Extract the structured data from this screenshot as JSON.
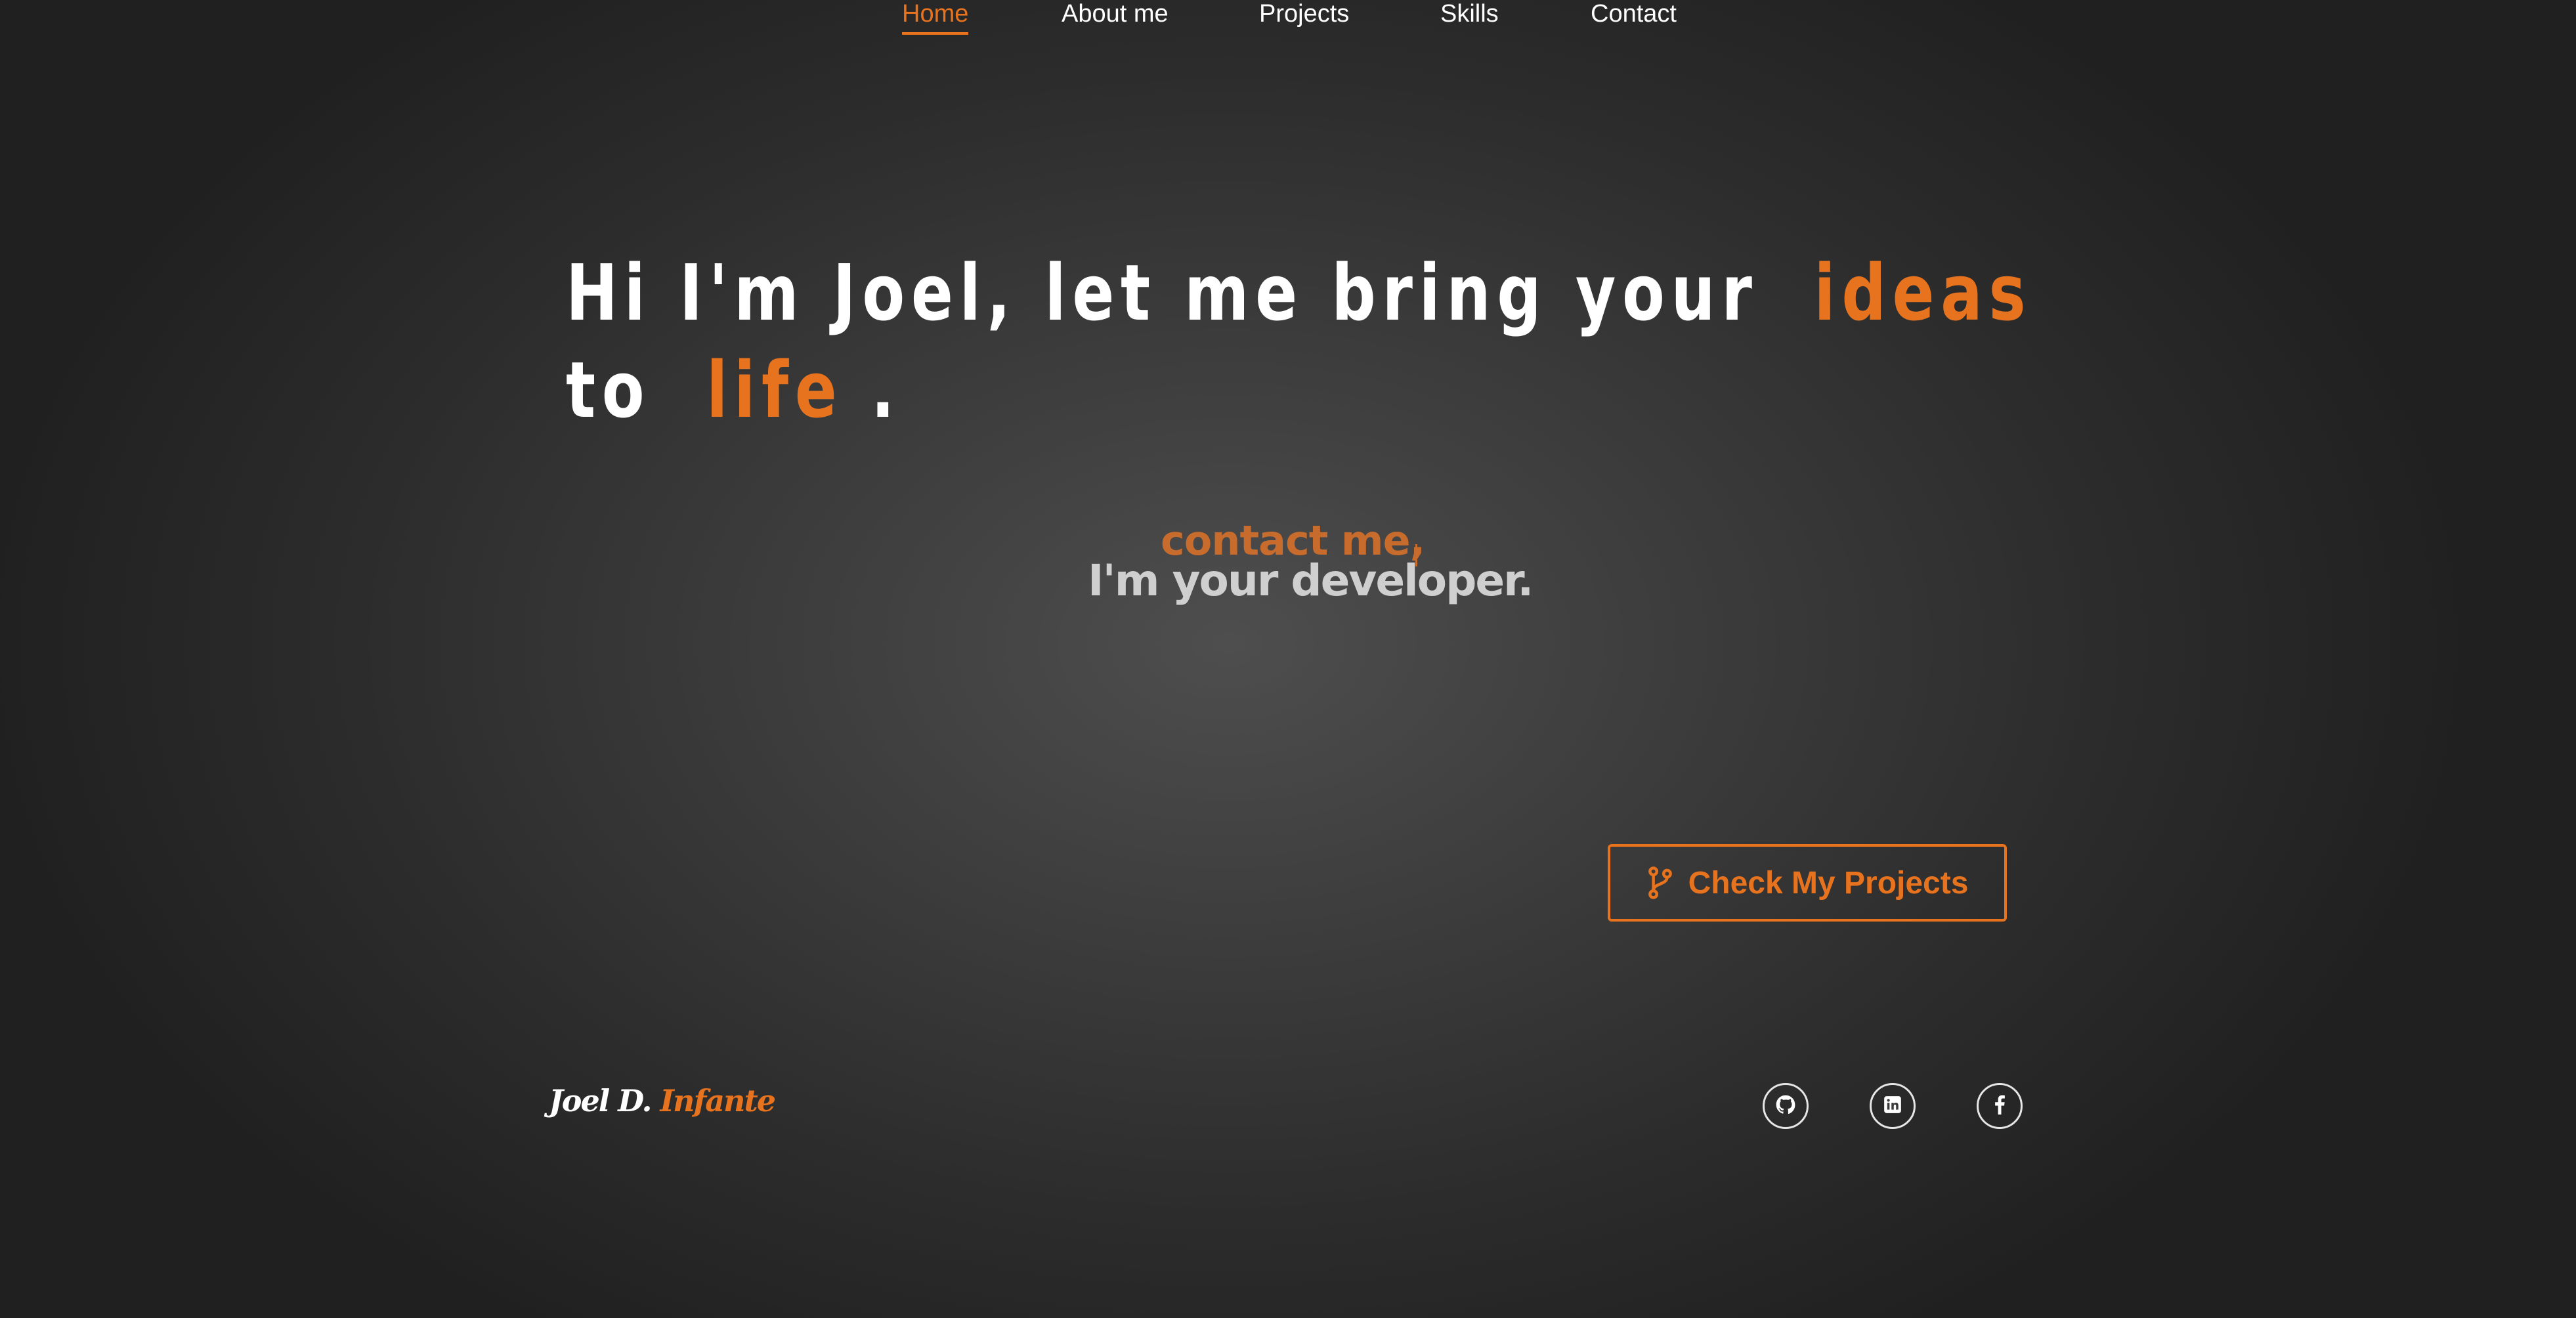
{
  "nav": {
    "items": [
      {
        "label": "Home",
        "active": true
      },
      {
        "label": "About me",
        "active": false
      },
      {
        "label": "Projects",
        "active": false
      },
      {
        "label": "Skills",
        "active": false
      },
      {
        "label": "Contact",
        "active": false
      }
    ]
  },
  "hero": {
    "line1_prefix": "Hi I'm Joel, let me bring your",
    "line1_accent": "ideas",
    "line2_prefix": "to",
    "line2_accent": "life",
    "line2_suffix": "."
  },
  "typed": {
    "text": "contact me,",
    "tagline": "I'm your developer."
  },
  "cta": {
    "label": "Check My Projects",
    "icon": "git-branch-icon"
  },
  "footer": {
    "brand_first": "Joel D.",
    "brand_last": "Infante",
    "social": [
      {
        "icon": "github-icon"
      },
      {
        "icon": "linkedin-icon"
      },
      {
        "icon": "facebook-icon"
      }
    ]
  },
  "colors": {
    "accent": "#e8731e",
    "typed": "#c86c2e",
    "tagline": "#cfcfcf",
    "text": "#ffffff"
  }
}
